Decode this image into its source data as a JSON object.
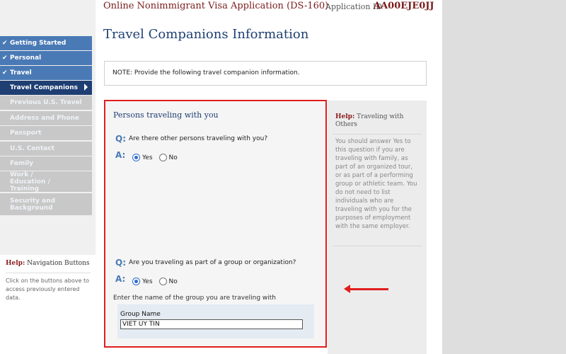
{
  "header": {
    "app_title": "Online Nonimmigrant Visa Application (DS-160)",
    "app_id_label": "Application ID",
    "app_id": "AA00EJE0JJ"
  },
  "page": {
    "title": "Travel Companions Information",
    "note": "NOTE: Provide the following travel companion information."
  },
  "nav": {
    "items": [
      {
        "label": "Getting Started",
        "state": "done",
        "check": "✔"
      },
      {
        "label": "Personal",
        "state": "done",
        "check": "✔"
      },
      {
        "label": "Travel",
        "state": "done",
        "check": "✔"
      },
      {
        "label": "Travel Companions",
        "state": "current"
      },
      {
        "label": "Previous U.S. Travel",
        "state": "pending"
      },
      {
        "label": "Address and Phone",
        "state": "pending"
      },
      {
        "label": "Passport",
        "state": "pending"
      },
      {
        "label": "U.S. Contact",
        "state": "pending"
      },
      {
        "label": "Family",
        "state": "pending"
      },
      {
        "label": "Work / Education / Training",
        "state": "pending"
      },
      {
        "label": "Security and Background",
        "state": "pending"
      }
    ]
  },
  "help_nav": {
    "help_word": "Help:",
    "title": "Navigation Buttons",
    "text": "Click on the buttons above to access previously entered data."
  },
  "form": {
    "section_title": "Persons traveling with you",
    "q_marker": "Q:",
    "a_marker": "A:",
    "q1": {
      "text": "Are there other persons traveling with you?",
      "yes": "Yes",
      "no": "No",
      "selected": "Yes"
    },
    "q2": {
      "text": "Are you traveling as part of a group or organization?",
      "yes": "Yes",
      "no": "No",
      "selected": "Yes"
    },
    "group_prompt": "Enter the name of the group you are traveling with",
    "group_label": "Group Name",
    "group_value": "VIET UY TIN"
  },
  "help": {
    "help_word": "Help:",
    "title": "Traveling with Others",
    "text": "You should answer Yes to this question if you are traveling with family, as part of an organized tour, or as part of a performing group or athletic team. You do not need to list individuals who are traveling with you for the purposes of employment with the same employer."
  },
  "colors": {
    "highlight": "#e11d1d",
    "nav_done": "#4a7ab5",
    "nav_current": "#1f3f73",
    "title_blue": "#1f3f73",
    "app_title_red": "#7a1c1c"
  }
}
